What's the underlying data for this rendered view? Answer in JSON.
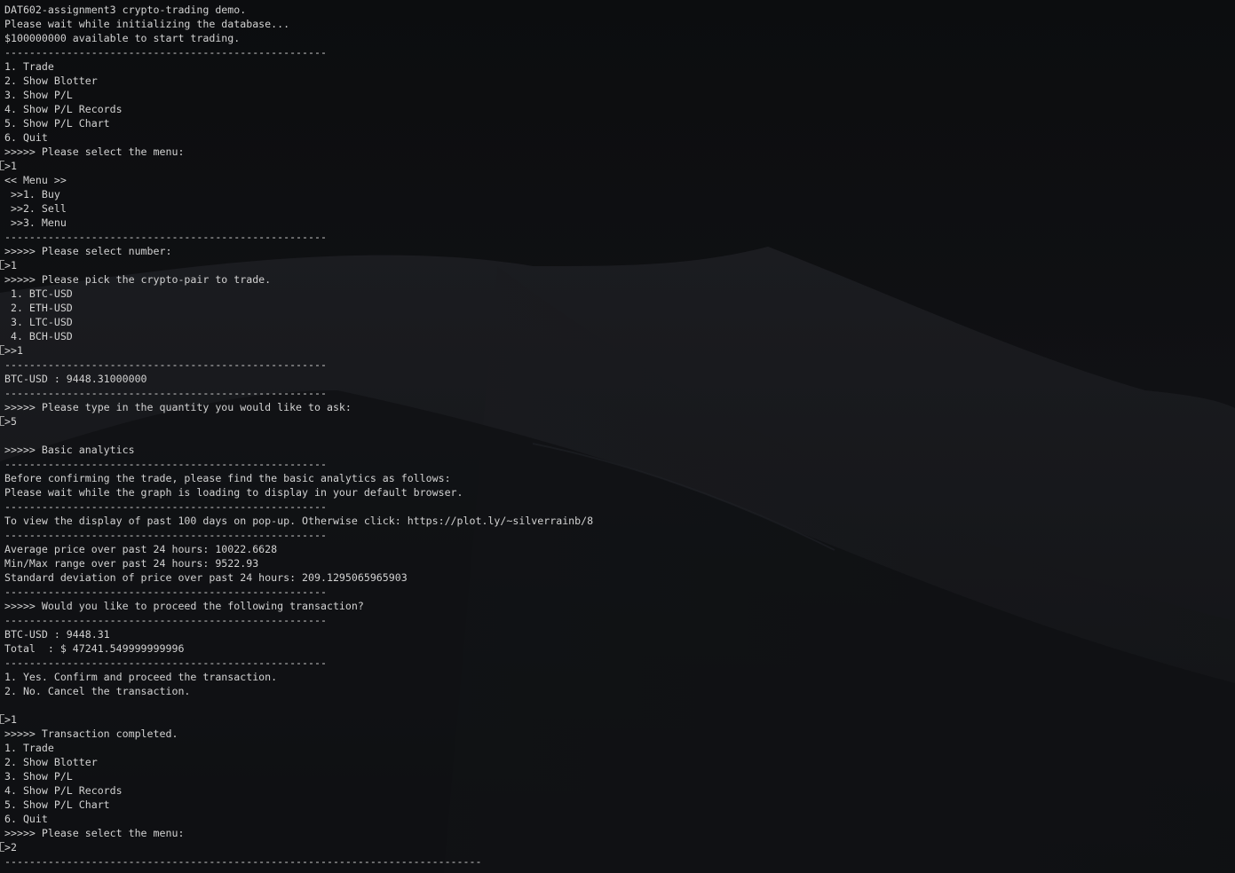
{
  "terminal": {
    "lines": [
      {
        "text": "----------------------------------------------------"
      },
      {
        "text": "DAT602-assignment3 crypto-trading demo."
      },
      {
        "text": "Please wait while initializing the database..."
      },
      {
        "text": "$100000000 available to start trading."
      },
      {
        "text": "----------------------------------------------------"
      },
      {
        "text": "1. Trade"
      },
      {
        "text": "2. Show Blotter"
      },
      {
        "text": "3. Show P/L"
      },
      {
        "text": "4. Show P/L Records"
      },
      {
        "text": "5. Show P/L Chart"
      },
      {
        "text": "6. Quit"
      },
      {
        "text": ">>>>> Please select the menu:"
      },
      {
        "text": ">1",
        "input": true
      },
      {
        "text": "<< Menu >>"
      },
      {
        "text": " >>1. Buy"
      },
      {
        "text": " >>2. Sell"
      },
      {
        "text": " >>3. Menu"
      },
      {
        "text": "----------------------------------------------------"
      },
      {
        "text": ">>>>> Please select number:"
      },
      {
        "text": ">1",
        "input": true
      },
      {
        "text": ">>>>> Please pick the crypto-pair to trade."
      },
      {
        "text": " 1. BTC-USD"
      },
      {
        "text": " 2. ETH-USD"
      },
      {
        "text": " 3. LTC-USD"
      },
      {
        "text": " 4. BCH-USD"
      },
      {
        "text": ">>1",
        "input": true
      },
      {
        "text": "----------------------------------------------------"
      },
      {
        "text": "BTC-USD : 9448.31000000"
      },
      {
        "text": "----------------------------------------------------"
      },
      {
        "text": ">>>>> Please type in the quantity you would like to ask:"
      },
      {
        "text": ">5",
        "input": true
      },
      {
        "text": ""
      },
      {
        "text": ">>>>> Basic analytics"
      },
      {
        "text": "----------------------------------------------------"
      },
      {
        "text": "Before confirming the trade, please find the basic analytics as follows:"
      },
      {
        "text": "Please wait while the graph is loading to display in your default browser."
      },
      {
        "text": "----------------------------------------------------"
      },
      {
        "text": "To view the display of past 100 days on pop-up. Otherwise click: https://plot.ly/~silverrainb/8"
      },
      {
        "text": "----------------------------------------------------"
      },
      {
        "text": "Average price over past 24 hours: 10022.6628"
      },
      {
        "text": "Min/Max range over past 24 hours: 9522.93"
      },
      {
        "text": "Standard deviation of price over past 24 hours: 209.1295065965903"
      },
      {
        "text": "----------------------------------------------------"
      },
      {
        "text": ">>>>> Would you like to proceed the following transaction?"
      },
      {
        "text": "----------------------------------------------------"
      },
      {
        "text": "BTC-USD : 9448.31"
      },
      {
        "text": "Total  : $ 47241.549999999996"
      },
      {
        "text": "----------------------------------------------------"
      },
      {
        "text": "1. Yes. Confirm and proceed the transaction."
      },
      {
        "text": "2. No. Cancel the transaction."
      },
      {
        "text": ""
      },
      {
        "text": ">1",
        "input": true
      },
      {
        "text": ">>>>> Transaction completed."
      },
      {
        "text": "1. Trade"
      },
      {
        "text": "2. Show Blotter"
      },
      {
        "text": "3. Show P/L"
      },
      {
        "text": "4. Show P/L Records"
      },
      {
        "text": "5. Show P/L Chart"
      },
      {
        "text": "6. Quit"
      },
      {
        "text": ">>>>> Please select the menu:"
      },
      {
        "text": ">2",
        "input": true
      },
      {
        "text": "-----------------------------------------------------------------------------"
      }
    ]
  },
  "colors": {
    "text": "#d2d2d2",
    "background": "#0c0d0f",
    "dune_shadow": "#16171b",
    "dune_light": "#1c1d21"
  }
}
